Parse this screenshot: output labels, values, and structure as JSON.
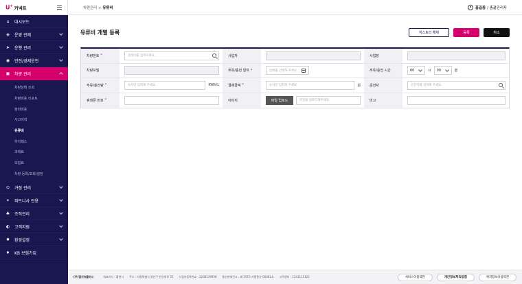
{
  "brand": {
    "logo": "U+",
    "name": "커넥트"
  },
  "sidebar": {
    "items": [
      {
        "label": "대시보드",
        "icon": "dashboard-icon",
        "glyph": "⌂"
      },
      {
        "label": "운영 관제",
        "icon": "monitor-icon",
        "glyph": "◈"
      },
      {
        "label": "운행 관리",
        "icon": "send-icon",
        "glyph": "➤"
      },
      {
        "label": "안전/경제운전",
        "icon": "shield-icon",
        "glyph": "◉"
      },
      {
        "label": "차량 관리",
        "icon": "car-icon",
        "glyph": "▣"
      }
    ],
    "submenu": [
      "차량상태 조회",
      "차량비용 리포트",
      "정비비용",
      "사고이력",
      "유류비",
      "하이패스",
      "과태료",
      "보험료",
      "차량 등록/조회/설정"
    ],
    "bottom_items": [
      {
        "label": "거점 관리",
        "icon": "location-icon",
        "glyph": "⊙"
      },
      {
        "label": "파트너사 전용",
        "icon": "partner-icon",
        "glyph": "✦"
      },
      {
        "label": "조직관리",
        "icon": "org-icon",
        "glyph": "♣"
      },
      {
        "label": "고객지원",
        "icon": "support-icon",
        "glyph": "◐"
      },
      {
        "label": "환경설정",
        "icon": "gear-icon",
        "glyph": "✹"
      },
      {
        "label": "KB 보험가입",
        "icon": "insurance-icon",
        "glyph": "♦"
      }
    ]
  },
  "topbar": {
    "breadcrumb_parent": "차량관리",
    "breadcrumb_sep": " > ",
    "breadcrumb_current": "유류비",
    "user_name": "홍길동",
    "user_role": "/ 총괄관리자"
  },
  "page": {
    "title": "유류비 개별 등록",
    "btn_history": "히스토리 해제",
    "btn_save": "등록",
    "btn_cancel": "취소"
  },
  "form": {
    "vehicle_no_label": "차량번호",
    "vehicle_no_placeholder": "검색어를 입력하세요.",
    "business_label": "사업자",
    "site_label": "사업장",
    "model_label": "차량모델",
    "date_label": "주유/충전 일자",
    "date_placeholder": "날짜를 선택해 주세요.",
    "time_label": "주유/충전 시간",
    "hour_value": "00",
    "hour_unit": "시",
    "minute_value": "00",
    "minute_unit": "분",
    "amount_label": "주유/충전량",
    "amount_placeholder": "숫자만 입력해 주세요.",
    "amount_unit": "KWh/L",
    "payment_label": "결제금액",
    "payment_placeholder": "숫자만 입력해 주세요.",
    "payment_unit": "원",
    "driver_label": "운전자",
    "driver_placeholder": "운전자를 검색해 주세요.",
    "phone_label": "휴대폰 번호",
    "image_label": "이미지",
    "upload_button": "파일 업로드",
    "upload_placeholder": "파일을 업로드해주세요.",
    "memo_label": "비고",
    "required_mark": "*"
  },
  "footer": {
    "company": "(주)엘지유플러스",
    "ceo": "대표이사 : 황현식",
    "address": "주소 : 서울특별시 용산구 한강대로 32",
    "biz_no": "사업자등록번호 : 2208139938",
    "comm_no": "통신판매신고 : 제 2015-서울용산-00481호",
    "contact": "고객센터 : 1141111122",
    "link_terms": "서비스이용약관",
    "link_privacy": "개인정보처리방침",
    "link_location": "위치정보이용약관"
  }
}
